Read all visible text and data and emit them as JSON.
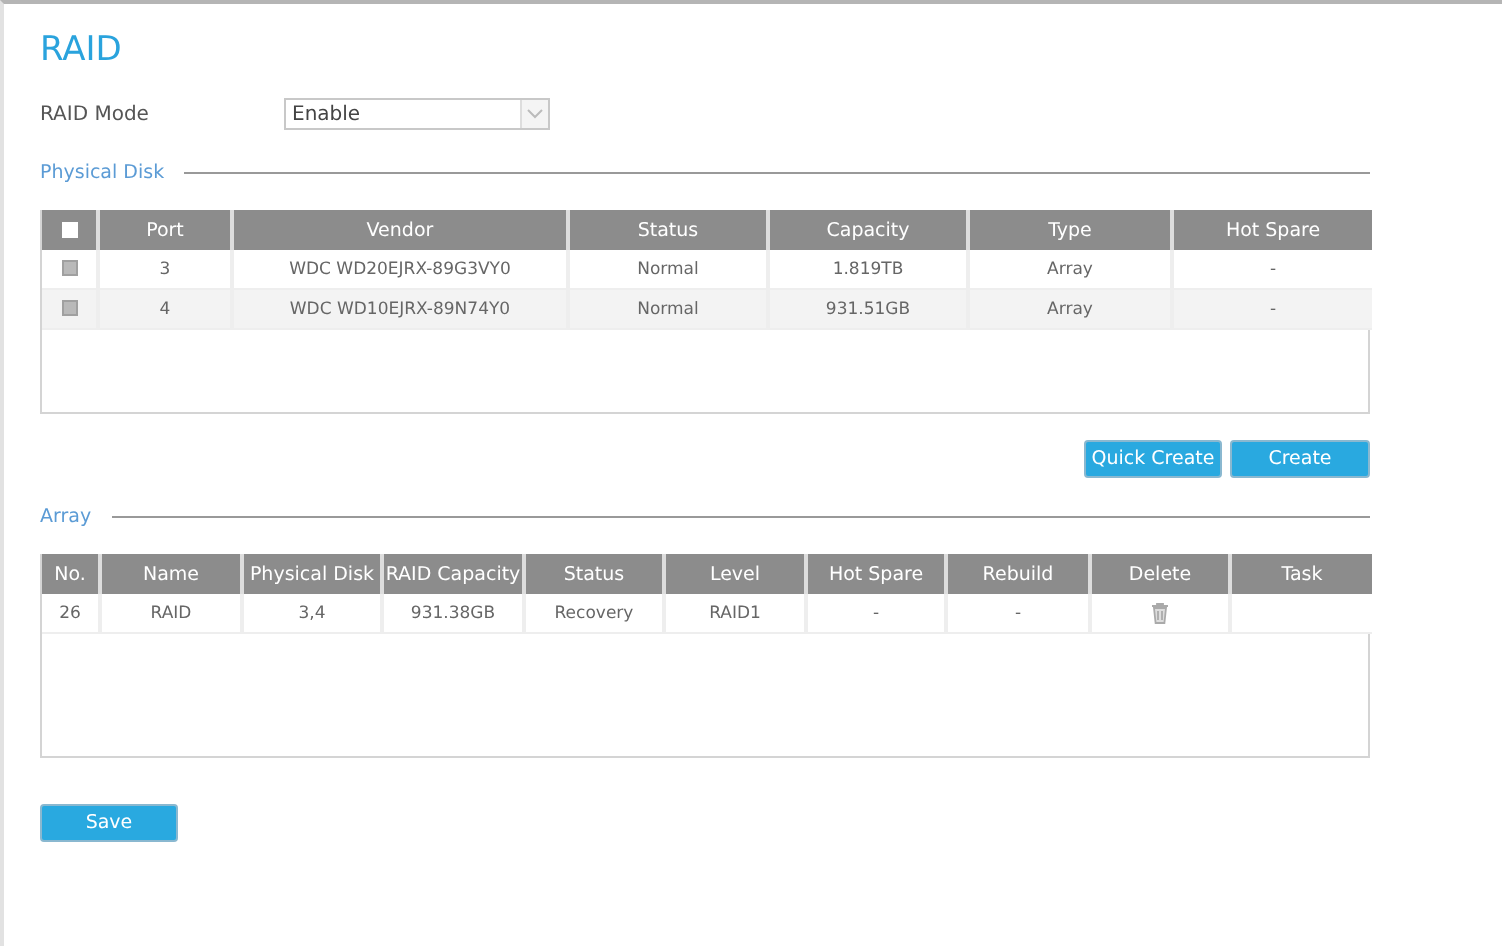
{
  "title": "RAID",
  "raid_mode": {
    "label": "RAID Mode",
    "value": "Enable"
  },
  "physical_disk": {
    "legend": "Physical Disk",
    "all_checked": false,
    "columns": [
      "Port",
      "Vendor",
      "Status",
      "Capacity",
      "Type",
      "Hot Spare"
    ],
    "rows": [
      {
        "checked": false,
        "cells": [
          "3",
          "WDC WD20EJRX-89G3VY0",
          "Normal",
          "1.819TB",
          "Array",
          "-"
        ]
      },
      {
        "checked": false,
        "cells": [
          "4",
          "WDC WD10EJRX-89N74Y0",
          "Normal",
          "931.51GB",
          "Array",
          "-"
        ]
      }
    ]
  },
  "disk_buttons": [
    "Quick Create",
    "Create"
  ],
  "array": {
    "legend": "Array",
    "columns": [
      "No.",
      "Name",
      "Physical Disk",
      "RAID Capacity",
      "Status",
      "Level",
      "Hot Spare",
      "Rebuild",
      "Delete",
      "Task"
    ],
    "rows": [
      {
        "cells": [
          "26",
          "RAID",
          "3,4",
          "931.38GB",
          "Recovery",
          "RAID1",
          "-",
          "-",
          {
            "kind": "delete"
          },
          ""
        ]
      }
    ]
  },
  "save_button": "Save"
}
